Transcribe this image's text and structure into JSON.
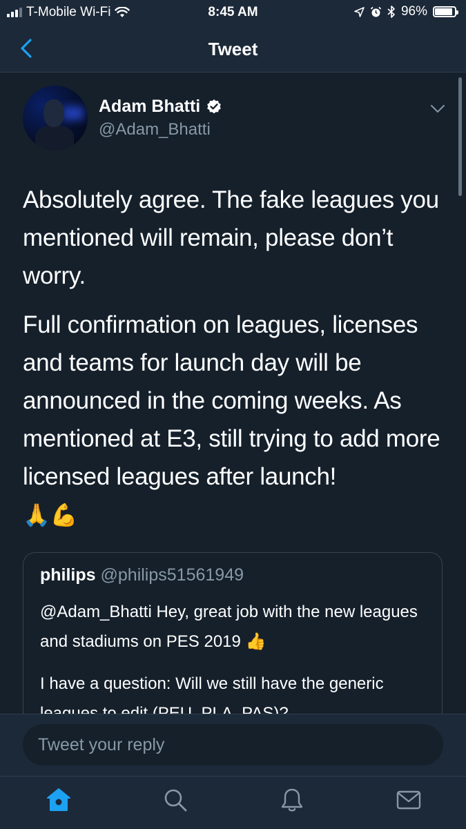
{
  "status_bar": {
    "carrier": "T-Mobile Wi-Fi",
    "time": "8:45 AM",
    "battery": "96%",
    "battery_level": 0.96
  },
  "nav": {
    "title": "Tweet"
  },
  "tweet": {
    "author_name": "Adam Bhatti",
    "author_handle": "@Adam_Bhatti",
    "verified": true,
    "text_1": "Absolutely agree. The fake leagues you mentioned will remain, please don’t worry.",
    "text_2": "Full confirmation on leagues, licenses and teams for launch day will be announced in the coming weeks. As mentioned at E3, still trying to add more licensed leagues after launch!",
    "emoji": "🙏💪"
  },
  "quoted_tweet": {
    "author_name": "philips",
    "author_handle": "@philips51561949",
    "text_1": "@Adam_Bhatti Hey, great job with the new leagues and stadiums on PES 2019 👍",
    "text_2": "I have a question: Will we still have the generic leagues to edit (PEU, PLA, PAS)?"
  },
  "reply": {
    "placeholder": "Tweet your reply"
  },
  "colors": {
    "background": "#15202b",
    "bar": "#1c2938",
    "accent": "#1da1f2",
    "secondary_text": "#8899a6"
  },
  "icons": {
    "back": "chevron-left-icon",
    "verified": "verified-badge-icon",
    "caret": "chevron-down-icon",
    "tabs": [
      "home-icon",
      "search-icon",
      "notifications-bell-icon",
      "messages-envelope-icon"
    ]
  }
}
